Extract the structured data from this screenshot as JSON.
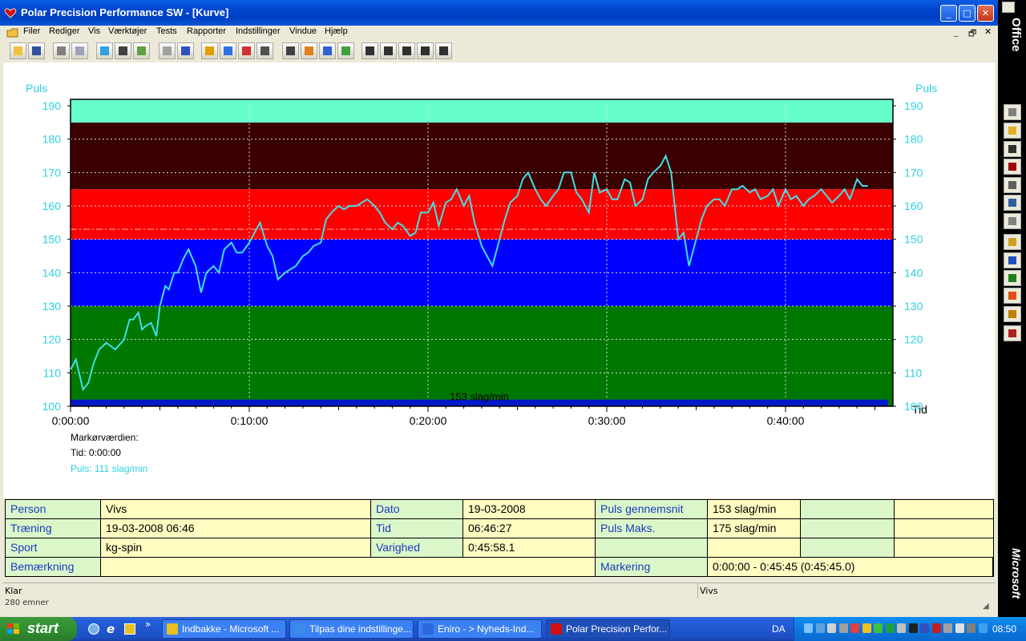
{
  "window": {
    "title": "Polar Precision Performance SW - [Kurve]",
    "controls": {
      "minimize": "_",
      "maximize": "□",
      "close": "✕"
    },
    "mdi_controls": {
      "minimize": "_",
      "restore": "🗗",
      "close": "✕"
    }
  },
  "menu": [
    "Filer",
    "Rediger",
    "Vis",
    "Værktøjer",
    "Tests",
    "Rapporter",
    "Indstillinger",
    "Vindue",
    "Hjælp"
  ],
  "toolbar": {
    "icons": [
      "open-icon",
      "save-icon",
      "print-icon",
      "copy-icon",
      "globe-icon",
      "sound-icon",
      "pen-icon",
      "calendar-icon",
      "book-icon",
      "area-chart-icon",
      "bar-chart-icon",
      "percent-chart-icon",
      "table-icon",
      "zoom-icon",
      "person-chart-icon",
      "arrow-chart-icon",
      "curve-icon",
      "bar1-icon",
      "bar2-icon",
      "bar3-icon",
      "bar4-icon",
      "bar5-icon"
    ]
  },
  "chart_data": {
    "type": "line",
    "ylabel": "Puls",
    "ylabel_right": "Puls",
    "xlabel": "Tid",
    "ylim": [
      100,
      190
    ],
    "yticks": [
      100,
      110,
      120,
      130,
      140,
      150,
      160,
      170,
      180,
      190
    ],
    "xticks": [
      "0:00:00",
      "0:10:00",
      "0:20:00",
      "0:30:00",
      "0:40:00"
    ],
    "xlim_minutes": [
      0,
      46
    ],
    "average_line": 153,
    "average_label": "153 slag/min",
    "zones": [
      {
        "from": 100,
        "to": 130,
        "color": "#007800"
      },
      {
        "from": 130,
        "to": 150,
        "color": "#0000ff"
      },
      {
        "from": 150,
        "to": 165,
        "color": "#ff0000"
      },
      {
        "from": 165,
        "to": 185,
        "color": "#3a0000"
      },
      {
        "from": 185,
        "to": 192,
        "color": "#66ffcc"
      }
    ],
    "series": [
      {
        "color": "#40e0e8",
        "x_minutes": [
          0,
          0.3,
          0.7,
          1,
          1.3,
          1.6,
          2,
          2.5,
          3,
          3.3,
          3.5,
          3.8,
          4,
          4.2,
          4.5,
          4.8,
          5,
          5.3,
          5.5,
          5.8,
          6,
          6.3,
          6.6,
          7,
          7.3,
          7.6,
          8,
          8.3,
          8.6,
          9,
          9.3,
          9.6,
          10,
          10.3,
          10.6,
          11,
          11.3,
          11.6,
          12,
          12.3,
          12.6,
          13,
          13.3,
          13.6,
          14,
          14.3,
          14.6,
          15,
          15.3,
          15.6,
          16,
          16.3,
          16.6,
          17,
          17.3,
          17.6,
          18,
          18.3,
          18.6,
          19,
          19.3,
          19.6,
          20,
          20.3,
          20.6,
          21,
          21.3,
          21.6,
          22,
          22.3,
          22.6,
          23,
          23.3,
          23.6,
          24,
          24.3,
          24.6,
          25,
          25.3,
          25.6,
          26,
          26.3,
          26.6,
          27,
          27.3,
          27.6,
          28,
          28.3,
          28.6,
          29,
          29.3,
          29.6,
          30,
          30.3,
          30.6,
          31,
          31.3,
          31.6,
          32,
          32.3,
          32.6,
          33,
          33.3,
          33.6,
          34,
          34.3,
          34.6,
          35,
          35.3,
          35.6,
          36,
          36.3,
          36.6,
          37,
          37.3,
          37.6,
          38,
          38.3,
          38.6,
          39,
          39.3,
          39.6,
          40,
          40.3,
          40.6,
          41,
          41.3,
          41.6,
          42,
          42.3,
          42.6,
          43,
          43.3,
          43.6,
          44,
          44.3,
          44.6,
          45,
          45.3,
          45.6
        ],
        "values": [
          111,
          114,
          105,
          107,
          113,
          117,
          119,
          117,
          120,
          126,
          126,
          128,
          123,
          124,
          125,
          121,
          130,
          136,
          135,
          140,
          140,
          144,
          147,
          142,
          134,
          140,
          142,
          140,
          147,
          149,
          146,
          146,
          149,
          152,
          155,
          148,
          145,
          138,
          140,
          141,
          142,
          145,
          146,
          148,
          149,
          156,
          158,
          160,
          159,
          160,
          160,
          161,
          162,
          160,
          158,
          155,
          153,
          155,
          154,
          151,
          152,
          158,
          158,
          161,
          154,
          161,
          162,
          165,
          160,
          163,
          155,
          148,
          145,
          142,
          150,
          156,
          161,
          163,
          168,
          170,
          165,
          162,
          160,
          163,
          165,
          170,
          170,
          164,
          162,
          158,
          170,
          164,
          165,
          162,
          162,
          168,
          167,
          160,
          162,
          168,
          170,
          172,
          175,
          170,
          150,
          152,
          142,
          150,
          156,
          160,
          162,
          162,
          160,
          165,
          165,
          166,
          164,
          165,
          162,
          163,
          165,
          160,
          165,
          162,
          163,
          160,
          162,
          163,
          165,
          163,
          161,
          163,
          165,
          162,
          168,
          166,
          166
        ]
      }
    ]
  },
  "marker": {
    "title": "Markørværdien:",
    "time": "Tid: 0:00:00",
    "pulse": "Puls: 111 slag/min"
  },
  "info": {
    "rows": [
      [
        "Person",
        "Vivs",
        "Dato",
        "19-03-2008",
        "Puls gennemsnit",
        "153 slag/min",
        "",
        ""
      ],
      [
        "Træning",
        "19-03-2008 06:46",
        "Tid",
        "06:46:27",
        "Puls Maks.",
        "175 slag/min",
        "",
        ""
      ],
      [
        "Sport",
        "kg-spin",
        "Varighed",
        "0:45:58.1",
        "",
        "",
        "",
        ""
      ],
      [
        "Bemærkning",
        "",
        "",
        "",
        "Markering",
        "0:00:00 - 0:45:45 (0:45:45.0)",
        "",
        ""
      ]
    ]
  },
  "status": {
    "left": "Klar",
    "right": "Vivs",
    "below": "280 emner"
  },
  "officebar": {
    "top_label": "Office",
    "bottom_label": "Microsoft"
  },
  "taskbar": {
    "start": "start",
    "quicklaunch_more": "»",
    "tasks": [
      {
        "label": "Indbakke - Microsoft ...",
        "icon_color": "#e8c020"
      },
      {
        "label": "Tilpas dine indstillinge...",
        "icon_color": "#3a8ae8"
      },
      {
        "label": "Eniro - > Nyheds-Ind...",
        "icon_color": "#2a6adf"
      },
      {
        "label": "Polar Precision Perfor...",
        "icon_color": "#d01010"
      }
    ],
    "lang": "DA",
    "clock": "08:50"
  }
}
